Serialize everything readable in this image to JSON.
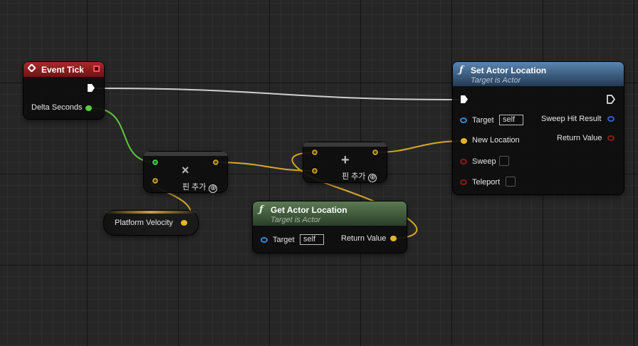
{
  "colors": {
    "exec_wire": "#cfcfcf",
    "float_wire": "#5ec83a",
    "vector_wire": "#d9a82a",
    "event_header": "#8b1e1e",
    "set_header": "#2c4a6a",
    "get_header": "#3d5a38",
    "object_pin": "#3a86c8",
    "bool_pin": "#8b1a1a"
  },
  "event_tick": {
    "title": "Event Tick",
    "icon": "event-diamond-icon",
    "delta_seconds_label": "Delta Seconds"
  },
  "multiply_node": {
    "symbol": "×",
    "add_pin_label": "핀 추가",
    "add_pin_icon": "⊕"
  },
  "add_node": {
    "symbol": "+",
    "add_pin_label": "핀 추가",
    "add_pin_icon": "⊕"
  },
  "platform_velocity": {
    "label": "Platform Velocity"
  },
  "set_actor_location": {
    "title": "Set Actor Location",
    "subtitle": "Target is Actor",
    "function_icon": "ƒ",
    "target_label": "Target",
    "target_value": "self",
    "new_location_label": "New Location",
    "sweep_label": "Sweep",
    "teleport_label": "Teleport",
    "sweep_hit_result_label": "Sweep Hit Result",
    "return_value_label": "Return Value"
  },
  "get_actor_location": {
    "title": "Get Actor Location",
    "subtitle": "Target is Actor",
    "function_icon": "ƒ",
    "target_label": "Target",
    "target_value": "self",
    "return_value_label": "Return Value"
  }
}
